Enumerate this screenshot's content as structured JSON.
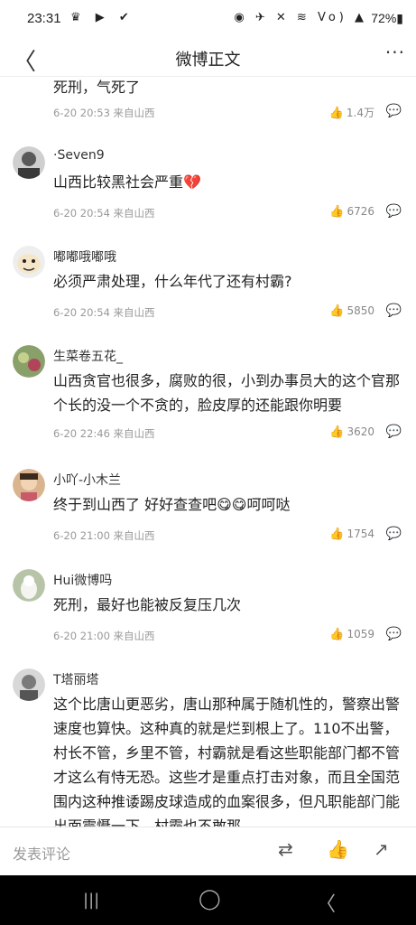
{
  "status_bar": {
    "time": "23:31",
    "left_icons": "♛ ▶ ✔",
    "right_icons": "◉ ✈ ✕ ≋ Vo) ▲",
    "battery": "72%▮"
  },
  "header": {
    "back_glyph": "〈",
    "title": "微博正文",
    "more_glyph": "···"
  },
  "comments": [
    {
      "username": "",
      "text": "死刑，气死了",
      "meta": "6-20 20:53 来自山西",
      "likes": "1.4万"
    },
    {
      "username": "·Seven9",
      "text": "山西比较黑社会严重💔",
      "meta": "6-20 20:54 来自山西",
      "likes": "6726"
    },
    {
      "username": "嘟嘟哦嘟哦",
      "text": "必须严肃处理，什么年代了还有村霸?",
      "meta": "6-20 20:54 来自山西",
      "likes": "5850"
    },
    {
      "username": "生菜卷五花_",
      "text": "山西贪官也很多，腐败的很，小到办事员大的这个官那个长的没一个不贪的，脸皮厚的还能跟你明要",
      "meta": "6-20 22:46 来自山西",
      "likes": "3620"
    },
    {
      "username": "小吖-小木兰",
      "text": "终于到山西了 好好查查吧😋😋呵呵哒",
      "meta": "6-20 21:00 来自山西",
      "likes": "1754"
    },
    {
      "username": "Hui微博吗",
      "text": "死刑，最好也能被反复压几次",
      "meta": "6-20 21:00 来自山西",
      "likes": "1059"
    },
    {
      "username": "T塔丽塔",
      "text": "这个比唐山更恶劣，唐山那种属于随机性的，警察出警速度也算快。这种真的就是烂到根上了。110不出警，村长不管，乡里不管，村霸就是看这些职能部门都不管才这么有恃无恐。这些才是重点打击对象，而且全国范围内这种推诿踢皮球造成的血案很多，但凡职能部门能出面震慑一下，村霸也不敢那",
      "meta": "",
      "likes": ""
    }
  ],
  "bottom_bar": {
    "comment_placeholder": "发表评论",
    "repost_icon": "⇄",
    "like_icon": "👍",
    "share_icon": "↗"
  },
  "system_nav": {
    "recent": "|||",
    "home": "◯",
    "back": "〈"
  },
  "icons": {
    "like": "thumb-up-icon",
    "reply": "comment-bubble-icon"
  },
  "colors": {
    "background": "#ffffff",
    "meta_text": "#999999",
    "sys_nav": "#000000"
  }
}
